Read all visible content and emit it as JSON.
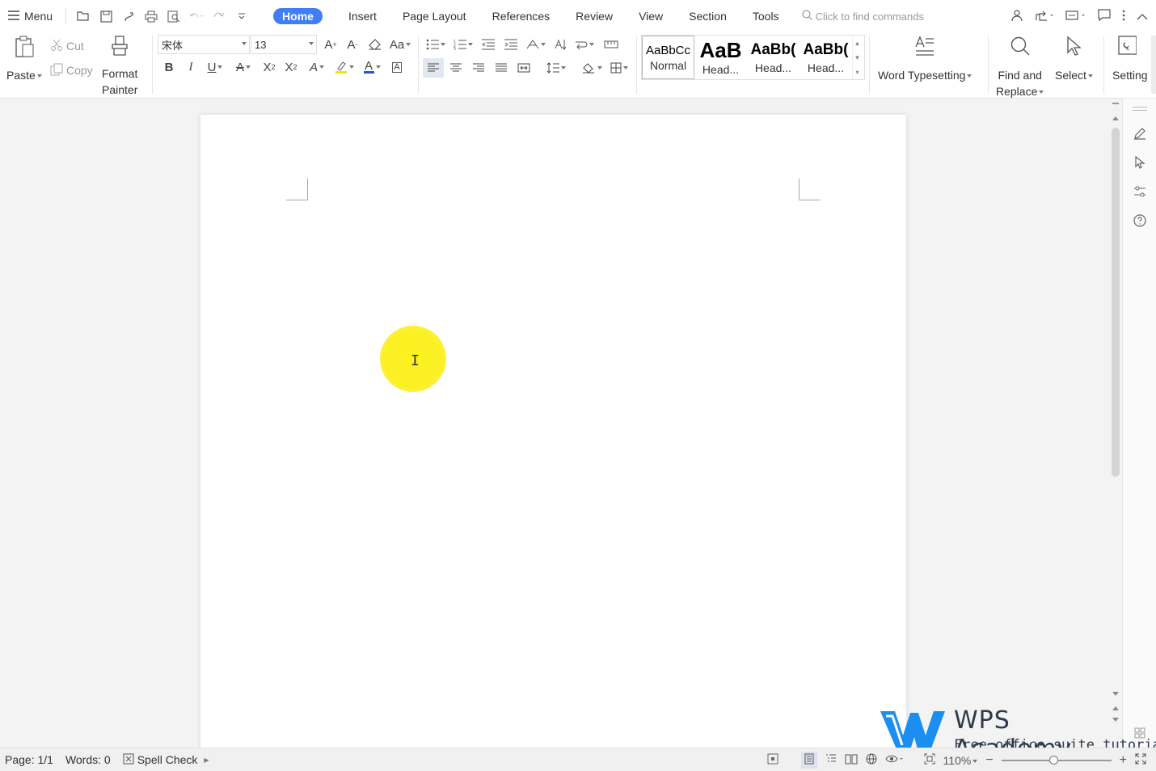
{
  "menubar": {
    "menu_label": "Menu",
    "tabs": [
      {
        "label": "Home",
        "active": true
      },
      {
        "label": "Insert"
      },
      {
        "label": "Page Layout"
      },
      {
        "label": "References"
      },
      {
        "label": "Review"
      },
      {
        "label": "View"
      },
      {
        "label": "Section"
      },
      {
        "label": "Tools"
      }
    ],
    "command_search_placeholder": "Click to find commands"
  },
  "ribbon": {
    "paste": "Paste",
    "cut": "Cut",
    "copy": "Copy",
    "format_painter_line1": "Format",
    "format_painter_line2": "Painter",
    "font_name": "宋体",
    "font_size": "13",
    "styles": [
      {
        "preview": "AaBbCc",
        "name": "Normal"
      },
      {
        "preview": "AaB",
        "name": "Head..."
      },
      {
        "preview": "AaBb(",
        "name": "Head..."
      },
      {
        "preview": "AaBb(",
        "name": "Head..."
      }
    ],
    "word_typesetting": "Word Typesetting",
    "find_replace_line1": "Find and",
    "find_replace_line2": "Replace",
    "select": "Select",
    "settings": "Setting"
  },
  "statusbar": {
    "page": "Page: 1/1",
    "words": "Words: 0",
    "spell_check": "Spell Check",
    "zoom": "110%",
    "zoom_fraction": 0.47
  },
  "watermark": {
    "title": "WPS Academy",
    "subtitle": "Free office suite tutorials"
  },
  "colors": {
    "accent": "#3f7ef5",
    "highlight": "#fbf024",
    "logo_blue": "#1b8ef2"
  }
}
